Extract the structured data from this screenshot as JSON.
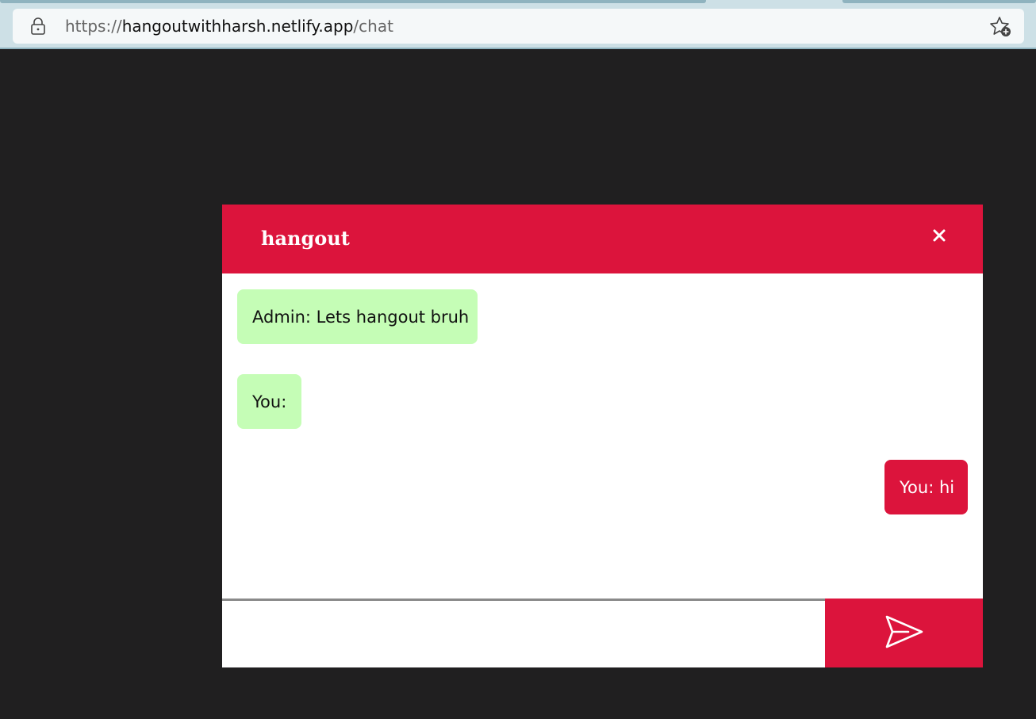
{
  "browser": {
    "url_scheme": "https://",
    "url_host": "hangoutwithharsh.netlify.app",
    "url_path": "/chat"
  },
  "chat": {
    "title": "hangout",
    "close_label": "×",
    "messages": [
      {
        "text": "Admin: Lets hangout bruh",
        "side": "left"
      },
      {
        "text": "You:",
        "side": "left"
      },
      {
        "text": "You: hi",
        "side": "right"
      }
    ],
    "input": {
      "value": "",
      "placeholder": ""
    }
  },
  "colors": {
    "accent": "#dc143c",
    "incoming_bubble": "#c5fdb6",
    "page_background": "#201f20"
  },
  "icons": {
    "lock": "lock-icon",
    "favorite": "add-favorite-icon",
    "close": "close-icon",
    "send": "send-icon"
  }
}
